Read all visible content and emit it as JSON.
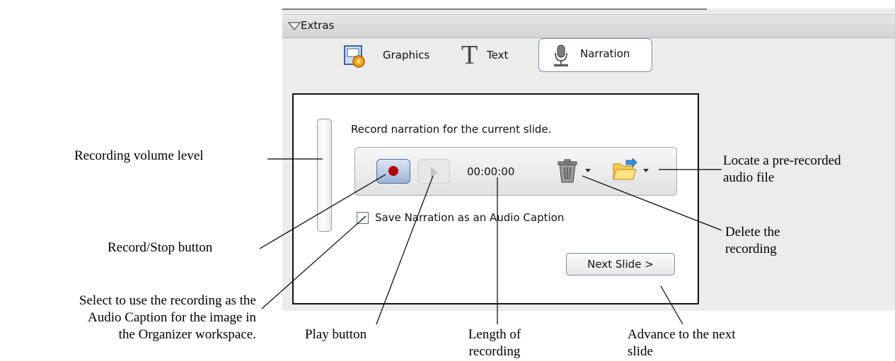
{
  "extras": {
    "title": "Extras",
    "tabs": [
      {
        "label": "Graphics",
        "icon": "graphics-icon"
      },
      {
        "label": "Text",
        "icon": "text-icon"
      },
      {
        "label": "Narration",
        "icon": "microphone-icon",
        "selected": true
      }
    ]
  },
  "narration": {
    "instruction": "Record narration for the current slide.",
    "time": "00:00:00",
    "save_caption_label": "Save Narration as an Audio Caption",
    "save_caption_checked": false,
    "next_slide_label": "Next Slide >",
    "volume_level": 0
  },
  "annotations": {
    "volume": "Recording volume level",
    "record": "Record/Stop button",
    "select_lines": [
      "Select to use the recording as the",
      "Audio Caption for the image in",
      "the Organizer workspace."
    ],
    "play": "Play button",
    "length_lines": [
      "Length of",
      "recording"
    ],
    "advance_lines": [
      "Advance to the next",
      "slide"
    ],
    "delete_lines": [
      "Delete the",
      "recording"
    ],
    "locate_lines": [
      "Locate a pre-recorded",
      "audio file"
    ]
  },
  "colors": {
    "record_dot": "#b00000",
    "button_border": "#6f8fb2",
    "panel_background": "#ececec"
  }
}
